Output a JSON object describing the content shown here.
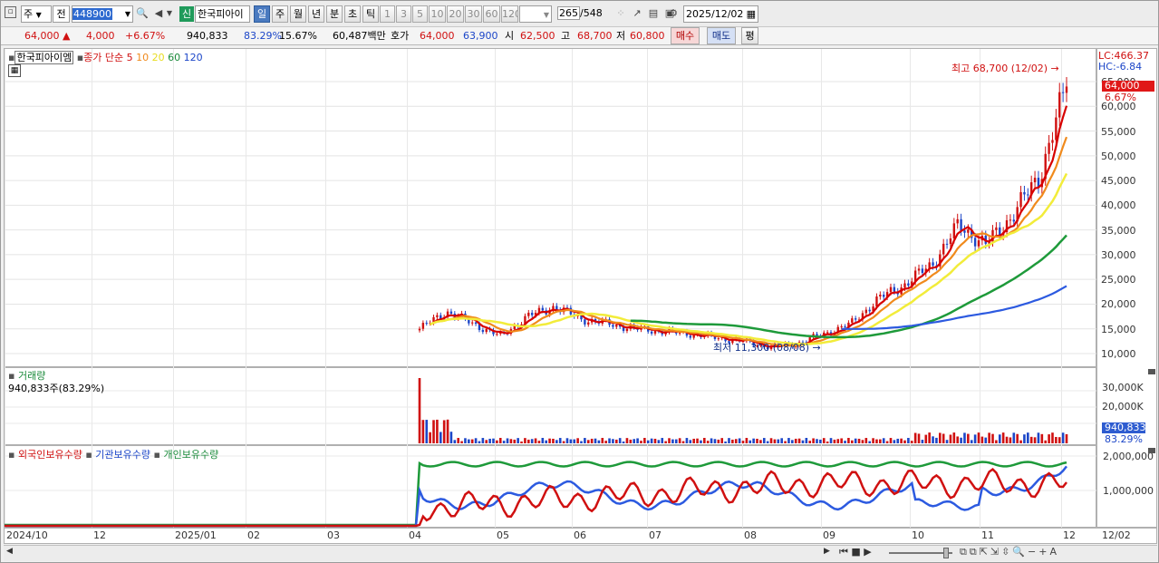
{
  "toolbar": {
    "type_label": "주",
    "prev_label": "전",
    "code": "448900",
    "badge": "신",
    "name": "한국피아이",
    "period_tabs": [
      "일",
      "주",
      "월",
      "년",
      "분",
      "초",
      "틱"
    ],
    "interval_tabs": [
      "1",
      "3",
      "5",
      "10",
      "20",
      "30",
      "60",
      "120"
    ],
    "count": "265",
    "total": "/548",
    "date": "2025/12/02"
  },
  "quote": {
    "price": "64,000",
    "change": "4,000",
    "pct": "+6.67%",
    "volume": "940,833",
    "vol_ratio": "83.29%",
    "turnover": "15.67%",
    "amount": "60,487백만",
    "ask_label": "호가",
    "ask": "64,000",
    "bid": "63,900",
    "open_label": "시",
    "open": "62,500",
    "high_label": "고",
    "high": "68,700",
    "low_label": "저",
    "low": "60,800",
    "buy_label": "매수",
    "sell_label": "매도",
    "avg_label": "평"
  },
  "price_panel": {
    "name": "한국피아이엠",
    "indicator": "종가 단순",
    "ma": [
      "5",
      "10",
      "20",
      "60",
      "120"
    ],
    "high_note": "최고 68,700 (12/02)",
    "low_note": "최저 11,300 (08/08)",
    "lc": "LC:466.37",
    "hc": "HC:-6.84",
    "last_price": "64,000",
    "last_pct": "6.67%",
    "y_ticks": [
      "65,000",
      "60,000",
      "55,000",
      "50,000",
      "45,000",
      "40,000",
      "35,000",
      "30,000",
      "25,000",
      "20,000",
      "15,000",
      "10,000"
    ]
  },
  "volume_panel": {
    "title": "거래량",
    "value": "940,833주(83.29%)",
    "y_ticks": [
      "30,000K",
      "20,000K"
    ],
    "last": "940,833",
    "last_pct": "83.29%"
  },
  "holder_panel": {
    "legend": [
      "외국인보유수량",
      "기관보유수량",
      "개인보유수량"
    ],
    "y_ticks": [
      "2,000,000",
      "1,000,000"
    ]
  },
  "x_axis": [
    "2024/10",
    "12",
    "2025/01",
    "02",
    "03",
    "04",
    "05",
    "06",
    "07",
    "08",
    "09",
    "10",
    "11",
    "12",
    "12/02"
  ],
  "colors": {
    "up": "#d01010",
    "down": "#1c46c8",
    "ma5": "#d80000",
    "ma10": "#f08a1c",
    "ma20": "#f2ec3a",
    "ma60": "#1e9a3a",
    "ma120": "#2c5ae0"
  },
  "chart_data": {
    "type": "line",
    "series": [
      {
        "name": "종가",
        "values": [
          15000,
          18500,
          16000,
          13500,
          17500,
          19500,
          17000,
          16000,
          15000,
          14500,
          14000,
          13200,
          12500,
          11300,
          12000,
          14000,
          16000,
          21000,
          24000,
          28000,
          36000,
          32000,
          38000,
          46000,
          64000
        ]
      }
    ]
  }
}
